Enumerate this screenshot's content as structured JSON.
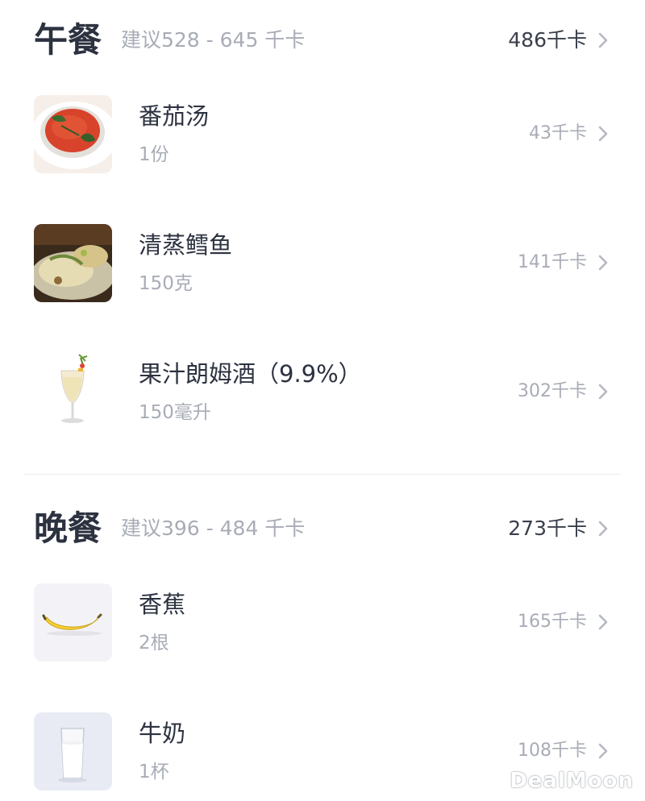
{
  "lunch": {
    "title": "午餐",
    "suggestion": "建议528 - 645 千卡",
    "total": "486千卡",
    "items": [
      {
        "name": "番茄汤",
        "portion": "1份",
        "kcal": "43千卡",
        "image": "tomato-soup-image"
      },
      {
        "name": "清蒸鳕鱼",
        "portion": "150克",
        "kcal": "141千卡",
        "image": "steamed-cod-image"
      },
      {
        "name": "果汁朗姆酒（9.9%）",
        "portion": "150毫升",
        "kcal": "302千卡",
        "image": "rum-cocktail-image"
      }
    ]
  },
  "dinner": {
    "title": "晚餐",
    "suggestion": "建议396 - 484 千卡",
    "total": "273千卡",
    "items": [
      {
        "name": "香蕉",
        "portion": "2根",
        "kcal": "165千卡",
        "image": "banana-image"
      },
      {
        "name": "牛奶",
        "portion": "1杯",
        "kcal": "108千卡",
        "image": "milk-glass-image"
      }
    ]
  },
  "icons": {
    "chevron": "chevron-right-icon"
  },
  "watermark": "DealMoon",
  "colors": {
    "primary_text": "#2c3240",
    "secondary_text": "#a8acb6",
    "divider": "#ececf0"
  }
}
